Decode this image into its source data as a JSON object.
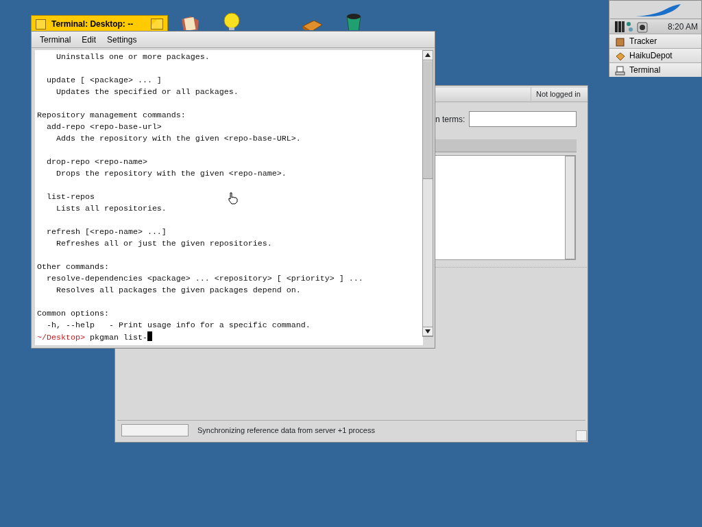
{
  "terminal": {
    "title": "Terminal: Desktop: --",
    "menu": [
      "Terminal",
      "Edit",
      "Settings"
    ],
    "blocks": [
      [
        "    Uninstalls one or more packages."
      ],
      [
        "  update [ <package> ... ]",
        "    Updates the specified or all packages."
      ],
      [
        "Repository management commands:",
        "  add-repo <repo-base-url>",
        "    Adds the repository with the given <repo-base-URL>."
      ],
      [
        "  drop-repo <repo-name>",
        "    Drops the repository with the given <repo-name>."
      ],
      [
        "  list-repos",
        "    Lists all repositories."
      ],
      [
        "  refresh [<repo-name> ...]",
        "    Refreshes all or just the given repositories."
      ],
      [
        "Other commands:",
        "  resolve-dependencies <package> ... <repository> [ <priority> ] ...",
        "    Resolves all packages the given packages depend on."
      ],
      [
        "Common options:",
        "  -h, --help   - Print usage info for a specific command."
      ]
    ],
    "prompt": {
      "path": "~/Desktop>",
      "command": "pkgman list-"
    }
  },
  "haikudepot": {
    "login_status": "Not logged in",
    "search_label": "n terms:",
    "status_text": "Synchronizing reference data from server +1 process"
  },
  "deskbar": {
    "clock": "8:20 AM",
    "apps": [
      "Tracker",
      "HaikuDepot",
      "Terminal"
    ]
  }
}
